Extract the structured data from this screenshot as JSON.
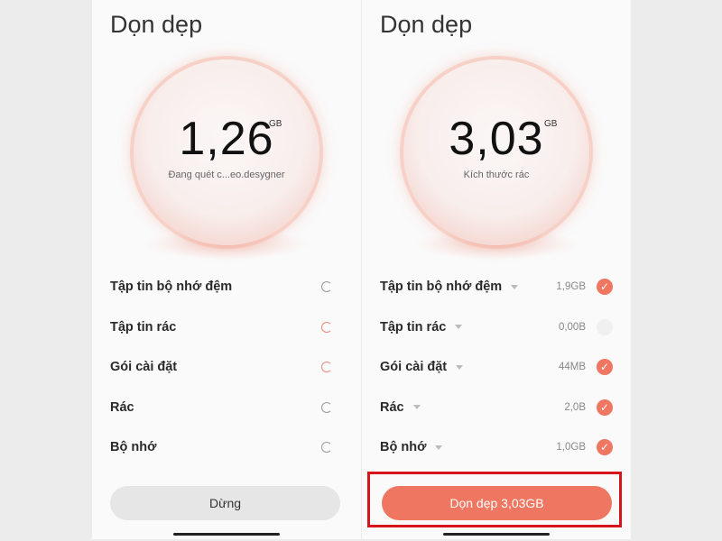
{
  "colors": {
    "accent": "#ef7660",
    "highlight_box": "#d7131b",
    "stop_button_bg": "#e6e6e6"
  },
  "left_screen": {
    "title": "Dọn dẹp",
    "size_value": "1,26",
    "size_unit": "GB",
    "status": "Đang quét c...eo.desygner",
    "items": [
      {
        "label": "Tập tin bộ nhớ đệm",
        "state": "scanning",
        "icon": "spinner-icon"
      },
      {
        "label": "Tập tin rác",
        "state": "scanning",
        "icon": "spinner-icon"
      },
      {
        "label": "Gói cài đặt",
        "state": "scanning",
        "icon": "spinner-icon"
      },
      {
        "label": "Rác",
        "state": "scanning",
        "icon": "spinner-icon"
      },
      {
        "label": "Bộ nhớ",
        "state": "scanning",
        "icon": "spinner-icon"
      }
    ],
    "stop_button": "Dừng"
  },
  "right_screen": {
    "title": "Dọn dẹp",
    "size_value": "3,03",
    "size_unit": "GB",
    "status": "Kích thước rác",
    "items": [
      {
        "label": "Tập tin bộ nhớ đệm",
        "size": "1,9GB",
        "checked": true
      },
      {
        "label": "Tập tin rác",
        "size": "0,00B",
        "checked": false
      },
      {
        "label": "Gói cài đặt",
        "size": "44MB",
        "checked": true
      },
      {
        "label": "Rác",
        "size": "2,0B",
        "checked": true
      },
      {
        "label": "Bộ nhớ",
        "size": "1,0GB",
        "checked": true
      }
    ],
    "clean_button": "Dọn dẹp 3,03GB"
  }
}
